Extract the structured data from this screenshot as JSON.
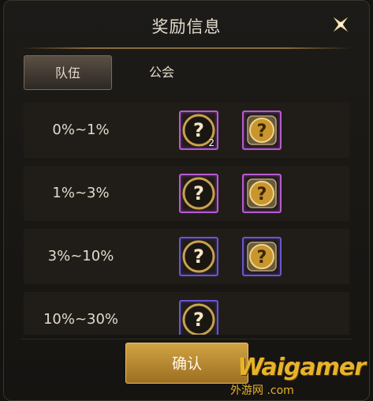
{
  "dialog": {
    "title": "奖励信息",
    "tabs": [
      {
        "label": "队伍",
        "active": true
      },
      {
        "label": "公会",
        "active": false
      }
    ],
    "rows": [
      {
        "range": "0%~1%",
        "items": [
          {
            "icon": "mystery-chest-icon",
            "rarity": "pink",
            "count": "2"
          },
          {
            "icon": "mystery-gold-chest-icon",
            "rarity": "pink",
            "count": ""
          }
        ]
      },
      {
        "range": "1%~3%",
        "items": [
          {
            "icon": "mystery-chest-icon",
            "rarity": "pink",
            "count": ""
          },
          {
            "icon": "mystery-gold-chest-icon",
            "rarity": "pink",
            "count": ""
          }
        ]
      },
      {
        "range": "3%~10%",
        "items": [
          {
            "icon": "mystery-chest-icon",
            "rarity": "purple",
            "count": ""
          },
          {
            "icon": "mystery-gold-chest-icon",
            "rarity": "purple",
            "count": ""
          }
        ]
      },
      {
        "range": "10%~30%",
        "items": [
          {
            "icon": "mystery-chest-icon",
            "rarity": "purple",
            "count": ""
          }
        ]
      }
    ],
    "confirm_label": "确认"
  },
  "watermark": {
    "main": "Waigamer",
    "sub": "外游网 .com"
  },
  "colors": {
    "accent": "#c89a3a",
    "pink_frame": "#b55ccf",
    "purple_frame": "#6c55cc"
  }
}
